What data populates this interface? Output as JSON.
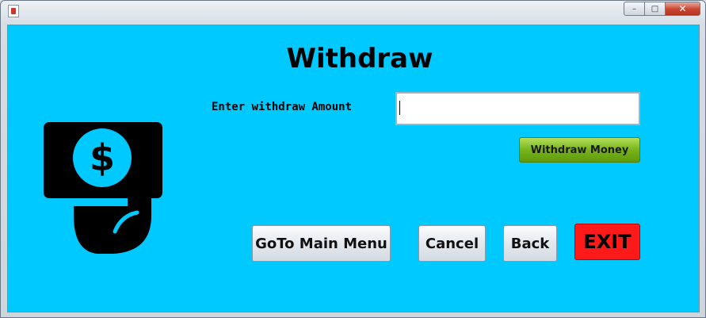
{
  "window": {
    "controls": {
      "minimize": "–",
      "maximize": "□",
      "close": "✕"
    }
  },
  "page": {
    "title": "Withdraw"
  },
  "form": {
    "amount_label": "Enter withdraw Amount",
    "amount_value": "",
    "amount_placeholder": "",
    "withdraw_button": "Withdraw Money"
  },
  "actions": {
    "main_menu": "GoTo Main Menu",
    "cancel": "Cancel",
    "back": "Back",
    "exit": "EXIT"
  },
  "icons": {
    "app": "java-app-icon",
    "illustration": "cash-withdraw-icon"
  },
  "colors": {
    "background": "#00c9ff",
    "withdraw_button": "#78b41c",
    "exit_button": "#ff1a1a",
    "icon": "#000000"
  }
}
